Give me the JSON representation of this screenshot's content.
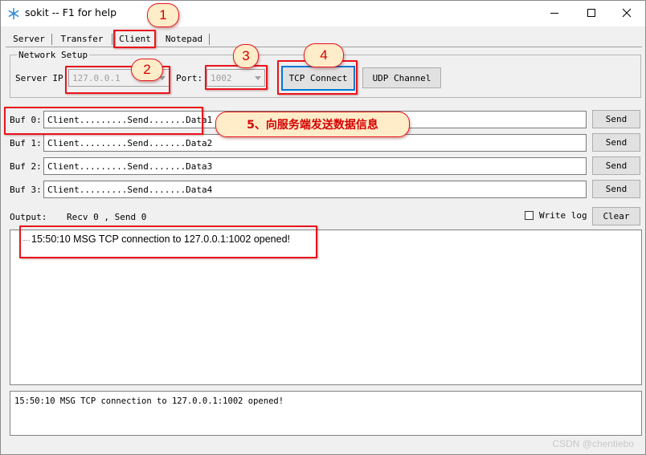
{
  "window": {
    "title": "sokit -- F1 for help",
    "icon": "snowflake-icon",
    "controls": [
      "minimize-icon",
      "maximize-icon",
      "close-icon"
    ]
  },
  "tabs": [
    {
      "label": "Server",
      "active": false
    },
    {
      "label": "Transfer",
      "active": false
    },
    {
      "label": "Client",
      "active": true
    },
    {
      "label": "Notepad",
      "active": false
    }
  ],
  "network_setup": {
    "legend": "Network Setup",
    "server_ip_label": "Server IP:",
    "server_ip_value": "127.0.0.1",
    "port_label": "Port:",
    "port_value": "1002",
    "tcp_button": "TCP Connect",
    "udp_button": "UDP Channel"
  },
  "buffers": [
    {
      "label": "Buf 0:",
      "value": "Client.........Send.......Data1",
      "send": "Send"
    },
    {
      "label": "Buf 1:",
      "value": "Client.........Send.......Data2",
      "send": "Send"
    },
    {
      "label": "Buf 2:",
      "value": "Client.........Send.......Data3",
      "send": "Send"
    },
    {
      "label": "Buf 3:",
      "value": "Client.........Send.......Data4",
      "send": "Send"
    }
  ],
  "output": {
    "label": "Output:",
    "counters": "Recv 0 , Send 0",
    "write_log_label": "Write log",
    "write_log_checked": false,
    "clear_button": "Clear",
    "lines": [
      "15:50:10 MSG TCP connection to 127.0.0.1:1002 opened!"
    ]
  },
  "status": {
    "line": "15:50:10 MSG TCP connection to 127.0.0.1:1002 opened!"
  },
  "watermark": "CSDN @chentiebo",
  "annotations": {
    "color": "#e8141c",
    "bubble_fill": "#ffecc8",
    "n1": "1",
    "n2": "2",
    "n3": "3",
    "n4": "4",
    "note5": "5、向服务端发送数据信息"
  }
}
